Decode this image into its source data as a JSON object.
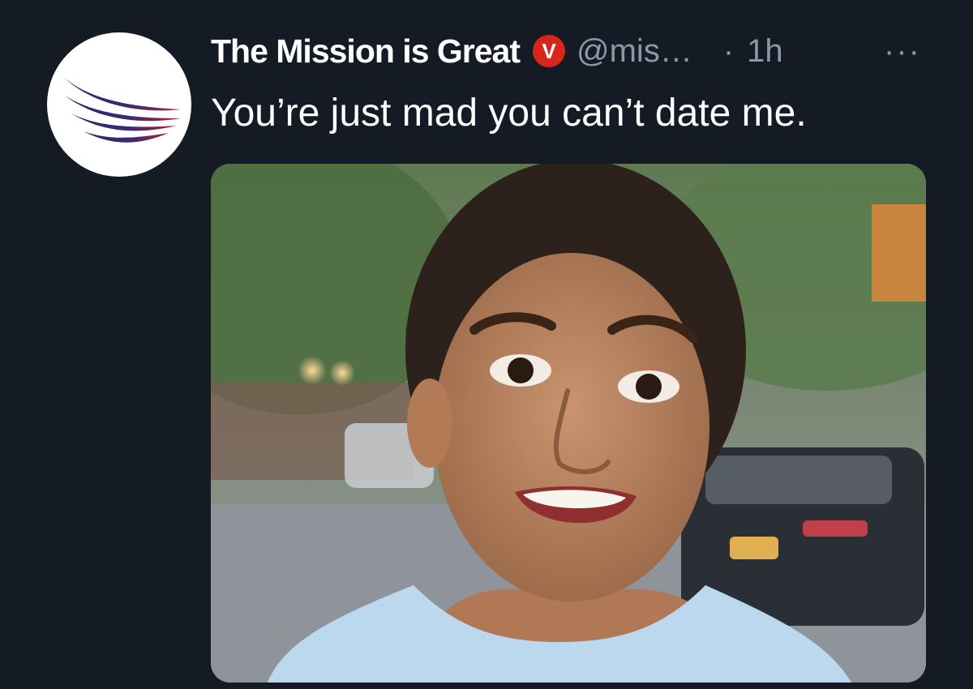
{
  "tweet": {
    "display_name": "The Mission is Great",
    "verified_badge_letter": "V",
    "handle": "@mis…",
    "separator": "·",
    "time": "1h",
    "more": "···",
    "text": "You’re just mad you can’t date me.",
    "avatar_icon": "swoosh-logo-icon",
    "media_icon": "photo-of-smiling-woman"
  },
  "colors": {
    "background": "#151b24",
    "name": "#ffffff",
    "secondary": "#8b98a5",
    "badge": "#d9261c"
  }
}
